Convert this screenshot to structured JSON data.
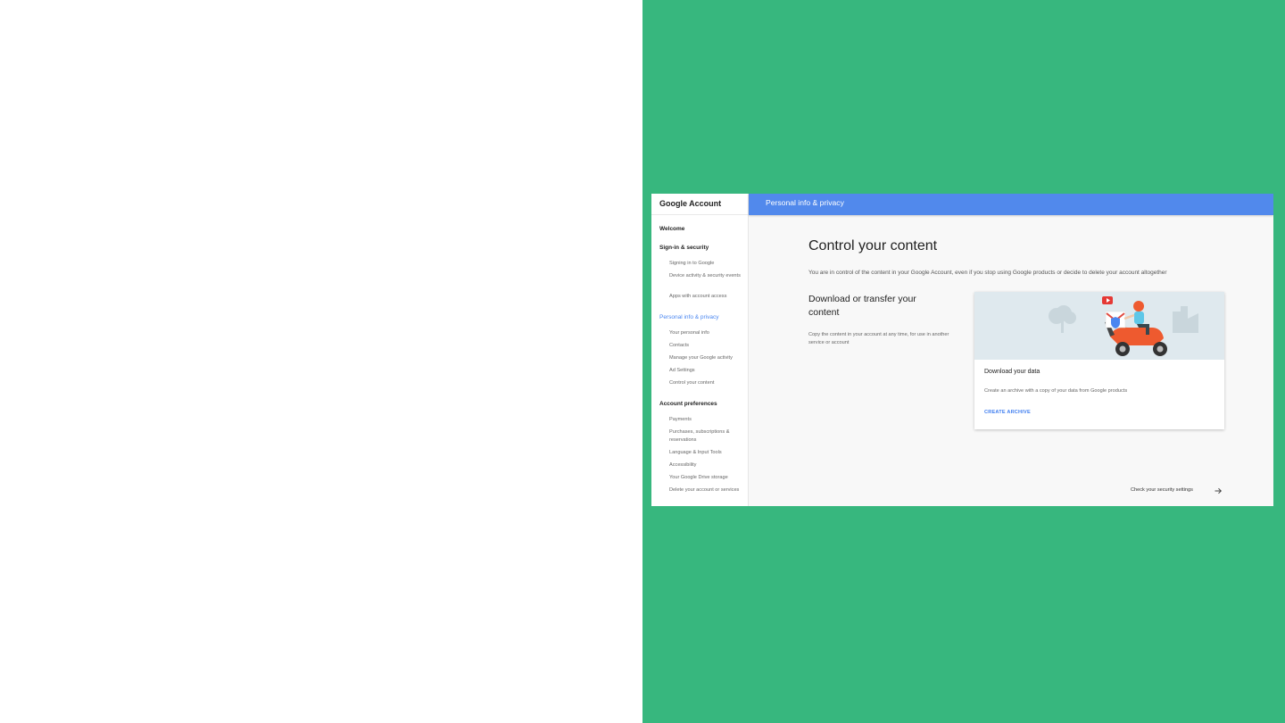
{
  "sidebar": {
    "brand": "Google Account",
    "sections": [
      {
        "label": "Welcome"
      },
      {
        "label": "Sign-in & security",
        "items": [
          "Signing in to Google",
          "Device activity & security events",
          "Apps with account access"
        ]
      },
      {
        "label": "Personal info & privacy",
        "active": true,
        "items": [
          "Your personal info",
          "Contacts",
          "Manage your Google activity",
          "Ad Settings",
          "Control your content"
        ]
      },
      {
        "label": "Account preferences",
        "items": [
          "Payments",
          "Purchases, subscriptions & reservations",
          "Language & Input Tools",
          "Accessibility",
          "Your Google Drive storage",
          "Delete your account or services"
        ]
      }
    ]
  },
  "topbar": {
    "title": "Personal info & privacy"
  },
  "main": {
    "title": "Control your content",
    "description": "You are in control of the content in your Google Account, even if you stop using Google products or decide to delete your account altogether",
    "section": {
      "title": "Download or transfer your content",
      "description": "Copy the content in your account at any time, for use in another service or account"
    },
    "card": {
      "title": "Download your data",
      "description": "Create an archive with a copy of your data from Google products",
      "action": "CREATE ARCHIVE",
      "illustration": "scooter-illustration"
    },
    "footer_link": "Check your security settings",
    "footer_icon": "arrow-right-icon"
  },
  "colors": {
    "background_panel": "#37b77e",
    "topbar": "#5189ec",
    "accent": "#3f7ef0",
    "active_nav": "#4a86f0"
  }
}
